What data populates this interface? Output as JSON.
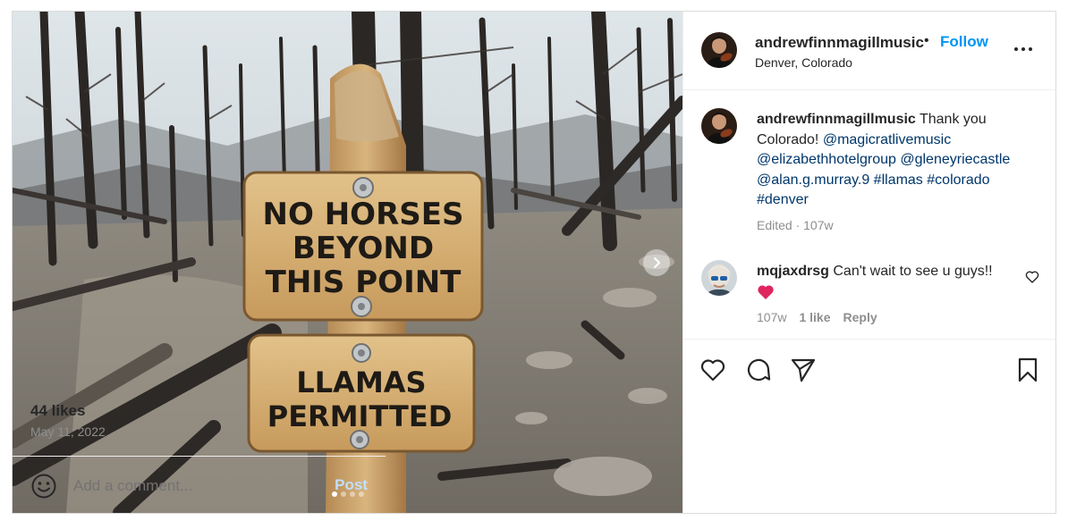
{
  "post": {
    "username": "andrewfinnmagillmusic",
    "bullet": "•",
    "follow_label": "Follow",
    "location": "Denver, Colorado",
    "more_icon": "more-horizontal-icon",
    "image": {
      "sign_top_lines": [
        "NO HORSES",
        "BEYOND",
        "THIS POINT"
      ],
      "sign_bottom_lines": [
        "LLAMAS",
        "PERMITTED"
      ],
      "carousel_count": 4,
      "carousel_active_index": 0,
      "next_icon": "chevron-right-icon"
    },
    "caption": {
      "username": "andrewfinnmagillmusic",
      "text_1": " Thank you Colorado! ",
      "mention_1": "@magicratlivemusic",
      "mention_2": "@elizabethhotelgroup",
      "mention_3": "@gleneyriecastle",
      "mention_4": "@alan.g.murray.9",
      "tag_1": "#llamas",
      "tag_2": "#colorado",
      "tag_3": "#denver",
      "meta": "Edited · 107w"
    },
    "comment": {
      "username": "mqjaxdrsg",
      "text": " Can't wait to see u guys!!",
      "time": "107w",
      "likes": "1 like",
      "reply_label": "Reply"
    },
    "actions": {
      "like_icon": "heart-icon",
      "comment_icon": "comment-icon",
      "share_icon": "share-icon",
      "save_icon": "bookmark-icon"
    },
    "likes_text": "44 likes",
    "date_text": "May 11, 2022",
    "add_comment": {
      "placeholder": "Add a comment...",
      "post_label": "Post"
    },
    "colors": {
      "link_blue": "#0095f6",
      "mention_blue": "#00376b",
      "post_disabled": "#c0dffd",
      "meta_gray": "#8e8e8e"
    }
  }
}
